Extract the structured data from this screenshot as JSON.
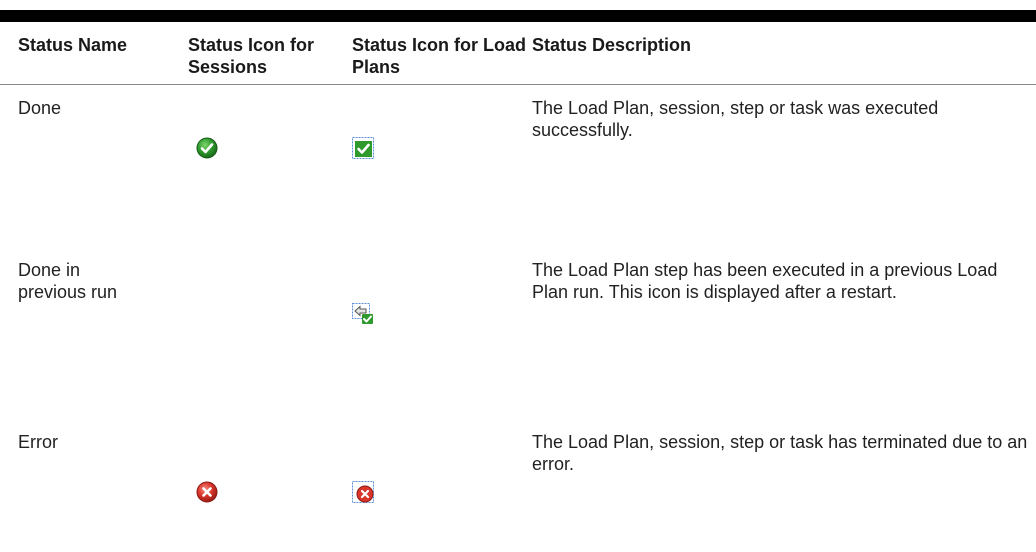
{
  "table": {
    "headers": [
      "Status Name",
      "Status Icon for Sessions",
      "Status Icon for Load Plans",
      "Status Description"
    ],
    "rows": [
      {
        "name": "Done",
        "session_icon": "check-circle-green-icon",
        "loadplan_icon": "loadplan-done-icon",
        "description": "The Load Plan, session, step or task was executed successfully."
      },
      {
        "name": "Done in previous run",
        "session_icon": "",
        "loadplan_icon": "loadplan-done-previous-run-icon",
        "description": "The Load Plan step has been executed in a previous Load Plan run. This icon is displayed after a restart."
      },
      {
        "name": "Error",
        "session_icon": "x-circle-red-icon",
        "loadplan_icon": "loadplan-error-icon",
        "description": "The Load Plan, session, step or task has terminated due to an error."
      }
    ]
  },
  "colors": {
    "success_green": "#2e9a2e",
    "error_red": "#d9352b",
    "icon_blue_border": "#5b8fd6"
  }
}
